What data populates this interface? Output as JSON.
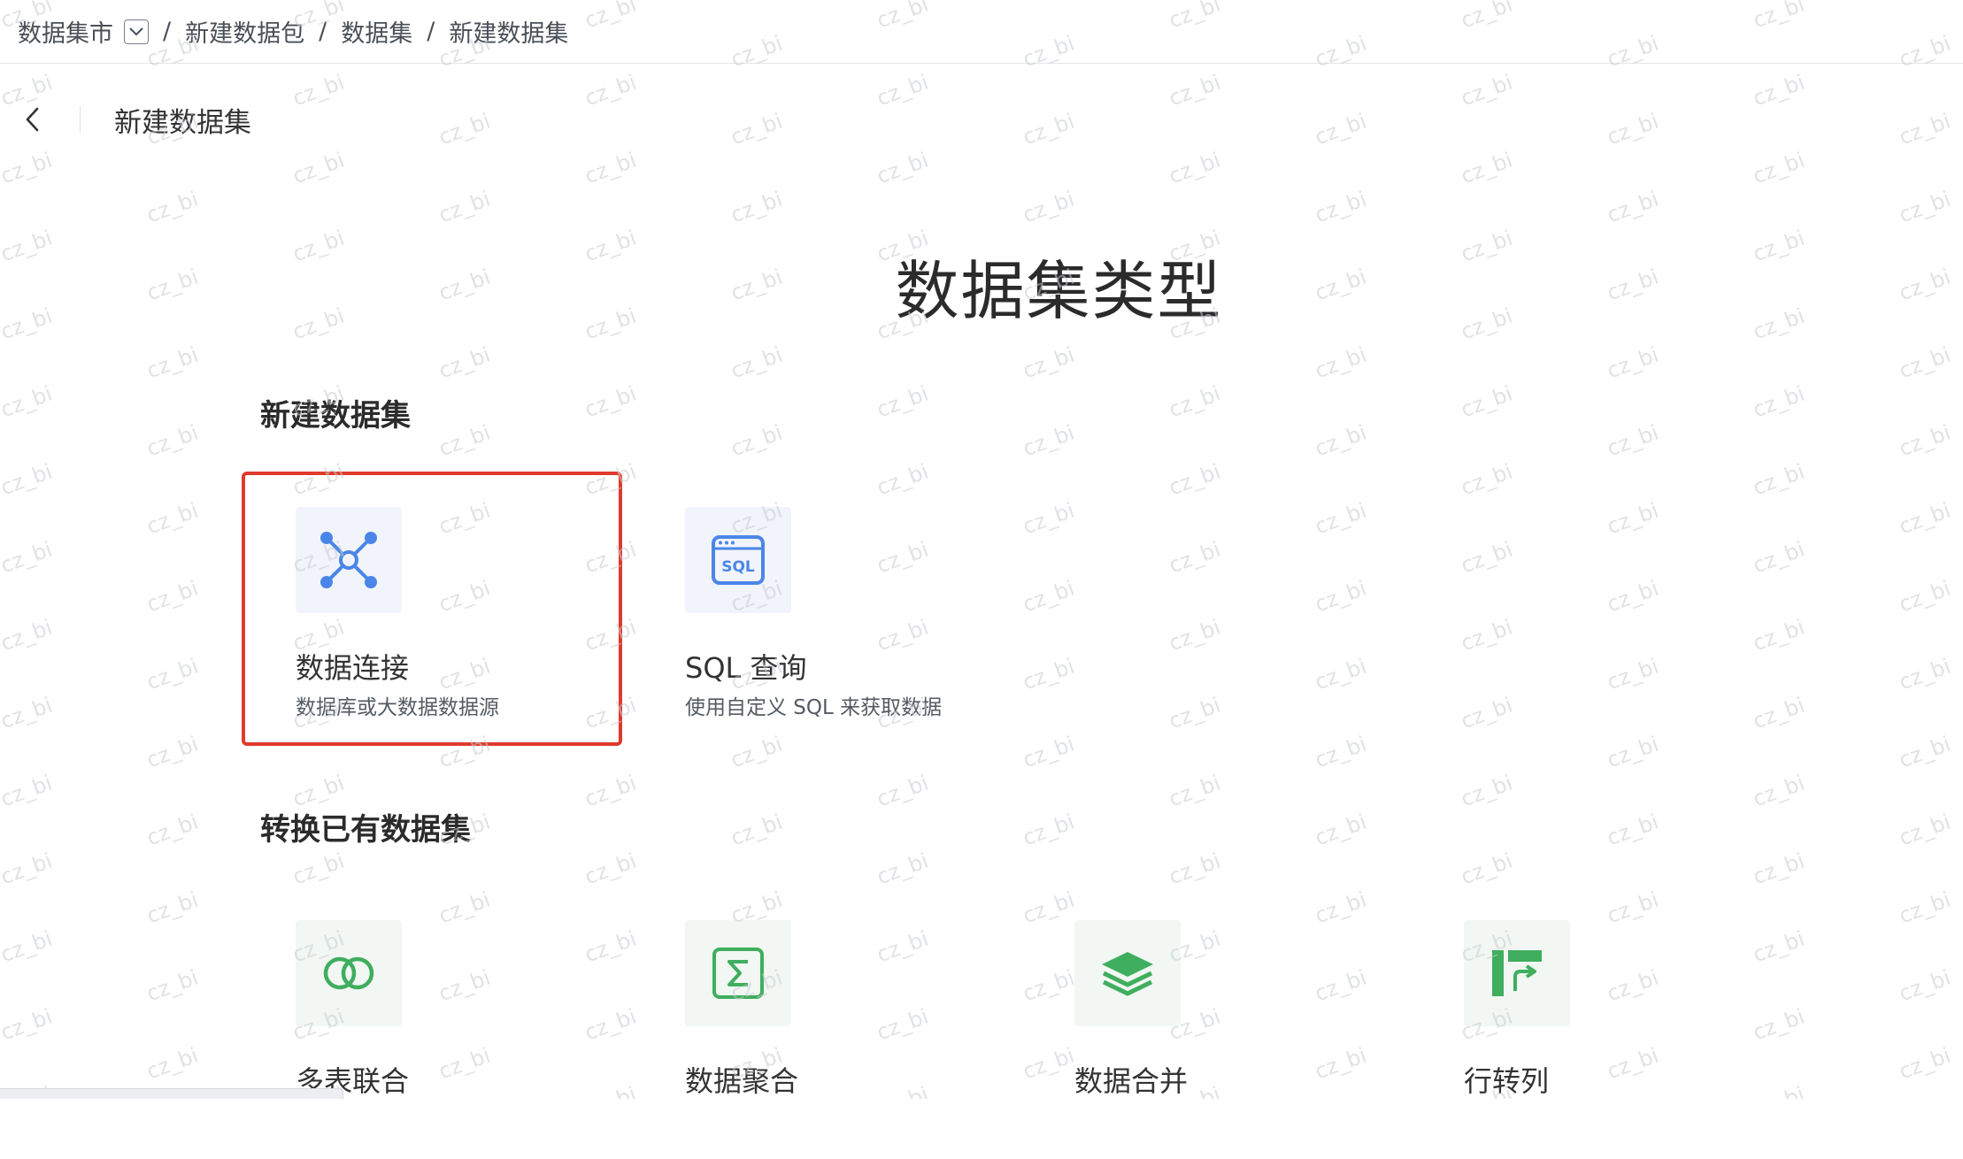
{
  "breadcrumb": {
    "items": [
      "数据集市",
      "新建数据包",
      "数据集",
      "新建数据集"
    ],
    "separator": "/"
  },
  "header": {
    "title": "新建数据集"
  },
  "main": {
    "title": "数据集类型"
  },
  "sections": {
    "new": {
      "title": "新建数据集",
      "cards": [
        {
          "title": "数据连接",
          "desc": "数据库或大数据数据源",
          "icon": "network-nodes-icon",
          "selected": true
        },
        {
          "title": "SQL 查询",
          "desc": "使用自定义 SQL 来获取数据",
          "icon": "sql-window-icon",
          "selected": false
        }
      ]
    },
    "convert": {
      "title": "转换已有数据集",
      "cards": [
        {
          "title": "多表联合",
          "icon": "venn-circles-icon"
        },
        {
          "title": "数据聚合",
          "icon": "sigma-icon"
        },
        {
          "title": "数据合并",
          "icon": "layers-icon"
        },
        {
          "title": "行转列",
          "icon": "pivot-icon"
        }
      ]
    }
  },
  "watermark": {
    "text": "cz_bi",
    "color": "#c8ccd2"
  },
  "colors": {
    "selected_border": "#e03a2c",
    "icon_blue": "#4a86e8",
    "icon_green": "#3fae5e"
  }
}
